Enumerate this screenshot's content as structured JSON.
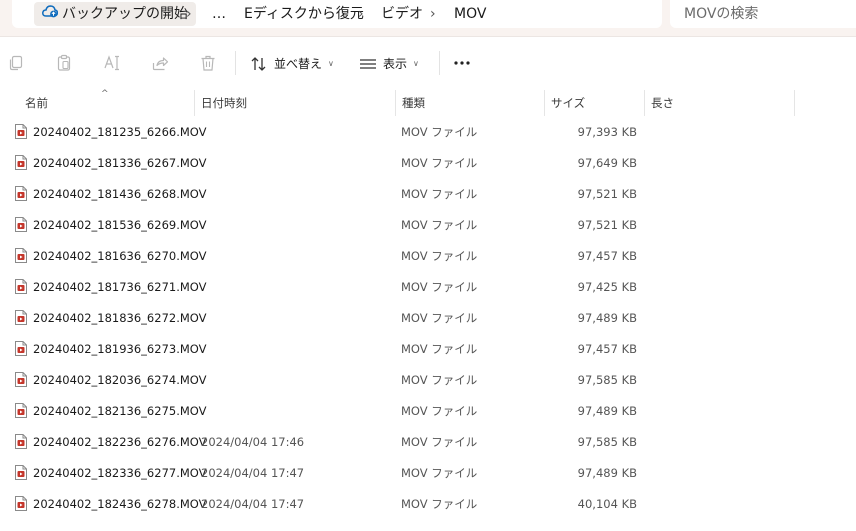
{
  "breadcrumb": {
    "items": [
      "バックアップの開始",
      "…",
      "Eディスクから復元",
      "ビデオ",
      "MOV"
    ],
    "separator": "›"
  },
  "search": {
    "placeholder": "MOVの検索"
  },
  "toolbar": {
    "icons": [
      "copy-icon",
      "paste-icon",
      "rename-icon",
      "share-icon",
      "delete-icon"
    ],
    "sort_label": "並べ替え",
    "view_label": "表示",
    "more_label": "…"
  },
  "columns": {
    "name": "名前",
    "date": "日付時刻",
    "type": "種類",
    "size": "サイズ",
    "length": "長さ"
  },
  "files": [
    {
      "name": "20240402_181235_6266.MOV",
      "date": "",
      "type": "MOV ファイル",
      "size": "97,393 KB"
    },
    {
      "name": "20240402_181336_6267.MOV",
      "date": "",
      "type": "MOV ファイル",
      "size": "97,649 KB"
    },
    {
      "name": "20240402_181436_6268.MOV",
      "date": "",
      "type": "MOV ファイル",
      "size": "97,521 KB"
    },
    {
      "name": "20240402_181536_6269.MOV",
      "date": "",
      "type": "MOV ファイル",
      "size": "97,521 KB"
    },
    {
      "name": "20240402_181636_6270.MOV",
      "date": "",
      "type": "MOV ファイル",
      "size": "97,457 KB"
    },
    {
      "name": "20240402_181736_6271.MOV",
      "date": "",
      "type": "MOV ファイル",
      "size": "97,425 KB"
    },
    {
      "name": "20240402_181836_6272.MOV",
      "date": "",
      "type": "MOV ファイル",
      "size": "97,489 KB"
    },
    {
      "name": "20240402_181936_6273.MOV",
      "date": "",
      "type": "MOV ファイル",
      "size": "97,457 KB"
    },
    {
      "name": "20240402_182036_6274.MOV",
      "date": "",
      "type": "MOV ファイル",
      "size": "97,585 KB"
    },
    {
      "name": "20240402_182136_6275.MOV",
      "date": "",
      "type": "MOV ファイル",
      "size": "97,489 KB"
    },
    {
      "name": "20240402_182236_6276.MOV",
      "date": "2024/04/04 17:46",
      "type": "MOV ファイル",
      "size": "97,585 KB"
    },
    {
      "name": "20240402_182336_6277.MOV",
      "date": "2024/04/04 17:47",
      "type": "MOV ファイル",
      "size": "97,489 KB"
    },
    {
      "name": "20240402_182436_6278.MOV",
      "date": "2024/04/04 17:47",
      "type": "MOV ファイル",
      "size": "40,104 KB"
    }
  ],
  "colors": {
    "titlebar_bg": "#f9f3f0",
    "file_icon_accent": "#c4362b",
    "cloud_icon": "#0f6cbd"
  }
}
